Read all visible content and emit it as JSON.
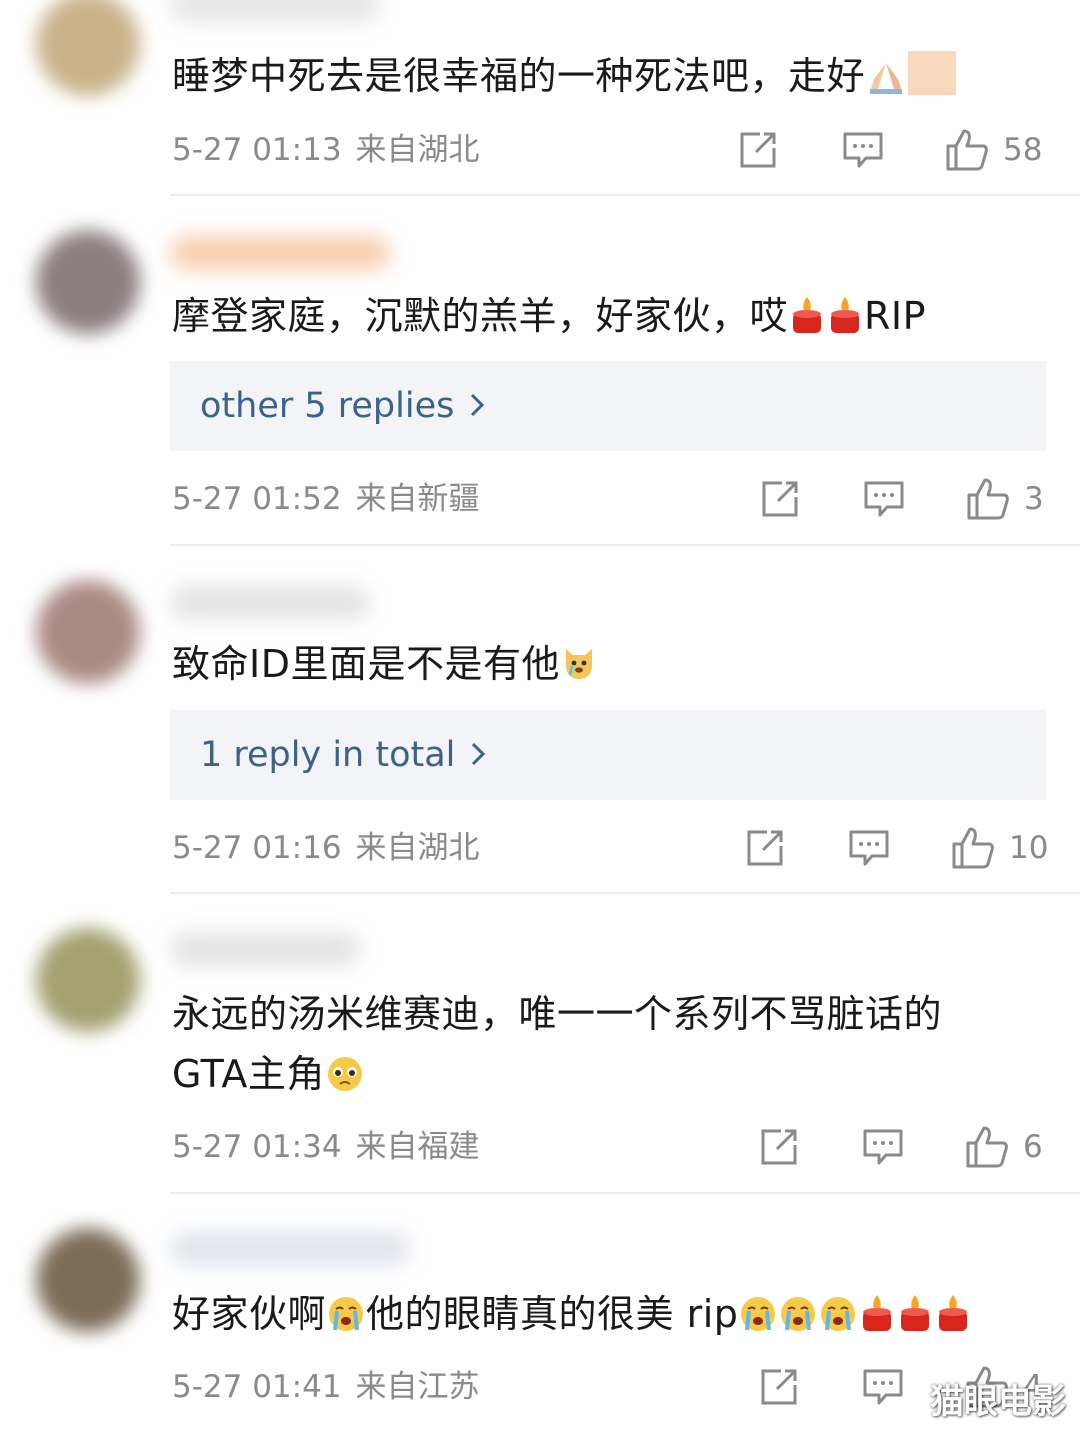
{
  "comments": [
    {
      "text": "睡梦中死去是很幸福的一种死法吧，走好",
      "timestamp": "5-27 01:13",
      "location": "来自湖北",
      "likes": "58",
      "avatar_color": "#c9b38a"
    },
    {
      "text": "摩登家庭，沉默的羔羊，好家伙，哎",
      "text_suffix": "RIP",
      "replies_label": "other 5 replies",
      "timestamp": "5-27 01:52",
      "location": "来自新疆",
      "likes": "3",
      "avatar_color": "#8d7f80"
    },
    {
      "text": "致命ID里面是不是有他",
      "replies_label": "1 reply in total",
      "timestamp": "5-27 01:16",
      "location": "来自湖北",
      "likes": "10",
      "avatar_color": "#a98b85"
    },
    {
      "text_line1": "永远的汤米维赛迪，唯一一个系列不骂脏话的",
      "text_line2": "GTA主角",
      "timestamp": "5-27 01:34",
      "location": "来自福建",
      "likes": "6",
      "avatar_color": "#a4a070"
    },
    {
      "text": "好家伙啊",
      "text_mid": "他的眼睛真的很美 rip",
      "timestamp": "5-27 01:41",
      "location": "来自江苏",
      "likes": "4",
      "avatar_color": "#7c6d58"
    }
  ],
  "icons": {
    "share": "share-icon",
    "comment": "comment-icon",
    "like": "thumbs-up-icon",
    "chevron": "chevron-right-icon"
  },
  "colors": {
    "link": "#3d6289",
    "meta": "#8a8a8a",
    "reply_box": "#f2f4f7"
  },
  "watermark": "猫眼电影"
}
